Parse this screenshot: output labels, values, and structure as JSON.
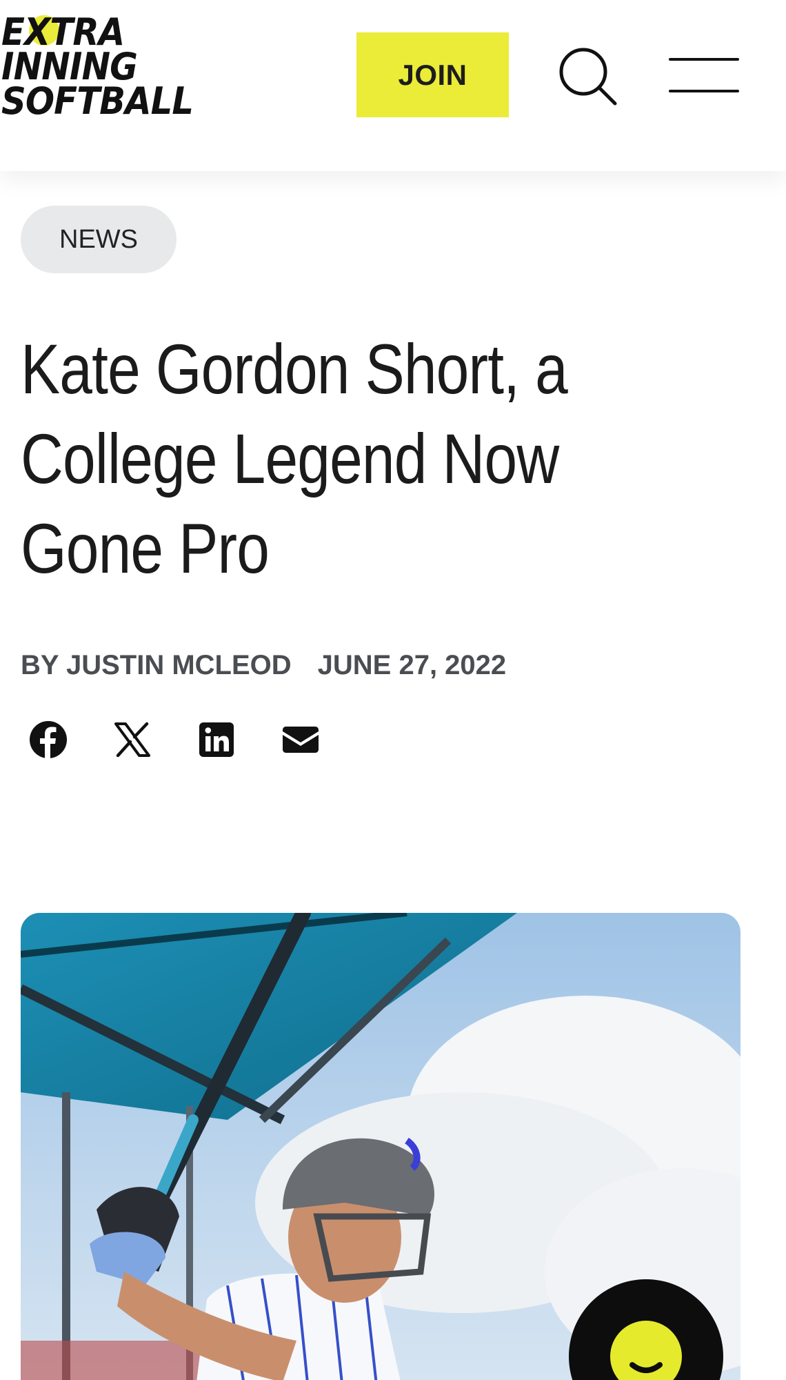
{
  "header": {
    "logo_lines": [
      "EXTRA",
      "INNING",
      "SOFTBALL"
    ],
    "logo_icon": "softball-icon",
    "join_label": "JOIN",
    "search_icon": "search-icon",
    "menu_icon": "hamburger-menu-icon"
  },
  "article": {
    "category": "NEWS",
    "title": "Kate Gordon Short, a College Legend Now Gone Pro",
    "byline": "BY JUSTIN MCLEOD",
    "date": "JUNE 27, 2022",
    "share_icons": [
      "facebook-icon",
      "x-icon",
      "linkedin-icon",
      "email-icon"
    ]
  },
  "colors": {
    "accent": "#ebec37",
    "tag_bg": "#e8e9ea",
    "meta_text": "#4a4d52",
    "fab_bg": "#0d0d0d"
  },
  "chat_widget": {
    "icon": "chat-smiley-icon"
  }
}
